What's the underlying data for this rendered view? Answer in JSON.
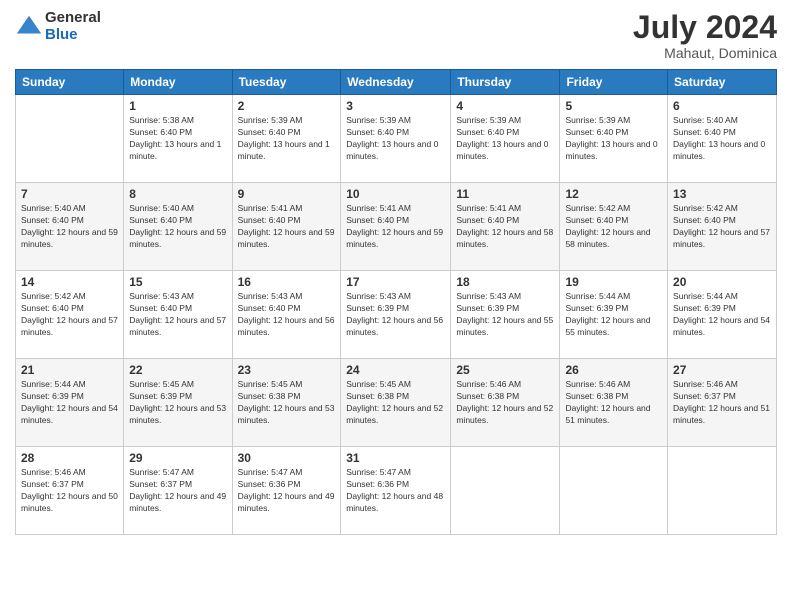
{
  "header": {
    "logo_general": "General",
    "logo_blue": "Blue",
    "month_year": "July 2024",
    "location": "Mahaut, Dominica"
  },
  "days_of_week": [
    "Sunday",
    "Monday",
    "Tuesday",
    "Wednesday",
    "Thursday",
    "Friday",
    "Saturday"
  ],
  "weeks": [
    [
      {
        "day": "",
        "sunrise": "",
        "sunset": "",
        "daylight": ""
      },
      {
        "day": "1",
        "sunrise": "Sunrise: 5:38 AM",
        "sunset": "Sunset: 6:40 PM",
        "daylight": "Daylight: 13 hours and 1 minute."
      },
      {
        "day": "2",
        "sunrise": "Sunrise: 5:39 AM",
        "sunset": "Sunset: 6:40 PM",
        "daylight": "Daylight: 13 hours and 1 minute."
      },
      {
        "day": "3",
        "sunrise": "Sunrise: 5:39 AM",
        "sunset": "Sunset: 6:40 PM",
        "daylight": "Daylight: 13 hours and 0 minutes."
      },
      {
        "day": "4",
        "sunrise": "Sunrise: 5:39 AM",
        "sunset": "Sunset: 6:40 PM",
        "daylight": "Daylight: 13 hours and 0 minutes."
      },
      {
        "day": "5",
        "sunrise": "Sunrise: 5:39 AM",
        "sunset": "Sunset: 6:40 PM",
        "daylight": "Daylight: 13 hours and 0 minutes."
      },
      {
        "day": "6",
        "sunrise": "Sunrise: 5:40 AM",
        "sunset": "Sunset: 6:40 PM",
        "daylight": "Daylight: 13 hours and 0 minutes."
      }
    ],
    [
      {
        "day": "7",
        "sunrise": "Sunrise: 5:40 AM",
        "sunset": "Sunset: 6:40 PM",
        "daylight": "Daylight: 12 hours and 59 minutes."
      },
      {
        "day": "8",
        "sunrise": "Sunrise: 5:40 AM",
        "sunset": "Sunset: 6:40 PM",
        "daylight": "Daylight: 12 hours and 59 minutes."
      },
      {
        "day": "9",
        "sunrise": "Sunrise: 5:41 AM",
        "sunset": "Sunset: 6:40 PM",
        "daylight": "Daylight: 12 hours and 59 minutes."
      },
      {
        "day": "10",
        "sunrise": "Sunrise: 5:41 AM",
        "sunset": "Sunset: 6:40 PM",
        "daylight": "Daylight: 12 hours and 59 minutes."
      },
      {
        "day": "11",
        "sunrise": "Sunrise: 5:41 AM",
        "sunset": "Sunset: 6:40 PM",
        "daylight": "Daylight: 12 hours and 58 minutes."
      },
      {
        "day": "12",
        "sunrise": "Sunrise: 5:42 AM",
        "sunset": "Sunset: 6:40 PM",
        "daylight": "Daylight: 12 hours and 58 minutes."
      },
      {
        "day": "13",
        "sunrise": "Sunrise: 5:42 AM",
        "sunset": "Sunset: 6:40 PM",
        "daylight": "Daylight: 12 hours and 57 minutes."
      }
    ],
    [
      {
        "day": "14",
        "sunrise": "Sunrise: 5:42 AM",
        "sunset": "Sunset: 6:40 PM",
        "daylight": "Daylight: 12 hours and 57 minutes."
      },
      {
        "day": "15",
        "sunrise": "Sunrise: 5:43 AM",
        "sunset": "Sunset: 6:40 PM",
        "daylight": "Daylight: 12 hours and 57 minutes."
      },
      {
        "day": "16",
        "sunrise": "Sunrise: 5:43 AM",
        "sunset": "Sunset: 6:40 PM",
        "daylight": "Daylight: 12 hours and 56 minutes."
      },
      {
        "day": "17",
        "sunrise": "Sunrise: 5:43 AM",
        "sunset": "Sunset: 6:39 PM",
        "daylight": "Daylight: 12 hours and 56 minutes."
      },
      {
        "day": "18",
        "sunrise": "Sunrise: 5:43 AM",
        "sunset": "Sunset: 6:39 PM",
        "daylight": "Daylight: 12 hours and 55 minutes."
      },
      {
        "day": "19",
        "sunrise": "Sunrise: 5:44 AM",
        "sunset": "Sunset: 6:39 PM",
        "daylight": "Daylight: 12 hours and 55 minutes."
      },
      {
        "day": "20",
        "sunrise": "Sunrise: 5:44 AM",
        "sunset": "Sunset: 6:39 PM",
        "daylight": "Daylight: 12 hours and 54 minutes."
      }
    ],
    [
      {
        "day": "21",
        "sunrise": "Sunrise: 5:44 AM",
        "sunset": "Sunset: 6:39 PM",
        "daylight": "Daylight: 12 hours and 54 minutes."
      },
      {
        "day": "22",
        "sunrise": "Sunrise: 5:45 AM",
        "sunset": "Sunset: 6:39 PM",
        "daylight": "Daylight: 12 hours and 53 minutes."
      },
      {
        "day": "23",
        "sunrise": "Sunrise: 5:45 AM",
        "sunset": "Sunset: 6:38 PM",
        "daylight": "Daylight: 12 hours and 53 minutes."
      },
      {
        "day": "24",
        "sunrise": "Sunrise: 5:45 AM",
        "sunset": "Sunset: 6:38 PM",
        "daylight": "Daylight: 12 hours and 52 minutes."
      },
      {
        "day": "25",
        "sunrise": "Sunrise: 5:46 AM",
        "sunset": "Sunset: 6:38 PM",
        "daylight": "Daylight: 12 hours and 52 minutes."
      },
      {
        "day": "26",
        "sunrise": "Sunrise: 5:46 AM",
        "sunset": "Sunset: 6:38 PM",
        "daylight": "Daylight: 12 hours and 51 minutes."
      },
      {
        "day": "27",
        "sunrise": "Sunrise: 5:46 AM",
        "sunset": "Sunset: 6:37 PM",
        "daylight": "Daylight: 12 hours and 51 minutes."
      }
    ],
    [
      {
        "day": "28",
        "sunrise": "Sunrise: 5:46 AM",
        "sunset": "Sunset: 6:37 PM",
        "daylight": "Daylight: 12 hours and 50 minutes."
      },
      {
        "day": "29",
        "sunrise": "Sunrise: 5:47 AM",
        "sunset": "Sunset: 6:37 PM",
        "daylight": "Daylight: 12 hours and 49 minutes."
      },
      {
        "day": "30",
        "sunrise": "Sunrise: 5:47 AM",
        "sunset": "Sunset: 6:36 PM",
        "daylight": "Daylight: 12 hours and 49 minutes."
      },
      {
        "day": "31",
        "sunrise": "Sunrise: 5:47 AM",
        "sunset": "Sunset: 6:36 PM",
        "daylight": "Daylight: 12 hours and 48 minutes."
      },
      {
        "day": "",
        "sunrise": "",
        "sunset": "",
        "daylight": ""
      },
      {
        "day": "",
        "sunrise": "",
        "sunset": "",
        "daylight": ""
      },
      {
        "day": "",
        "sunrise": "",
        "sunset": "",
        "daylight": ""
      }
    ]
  ]
}
